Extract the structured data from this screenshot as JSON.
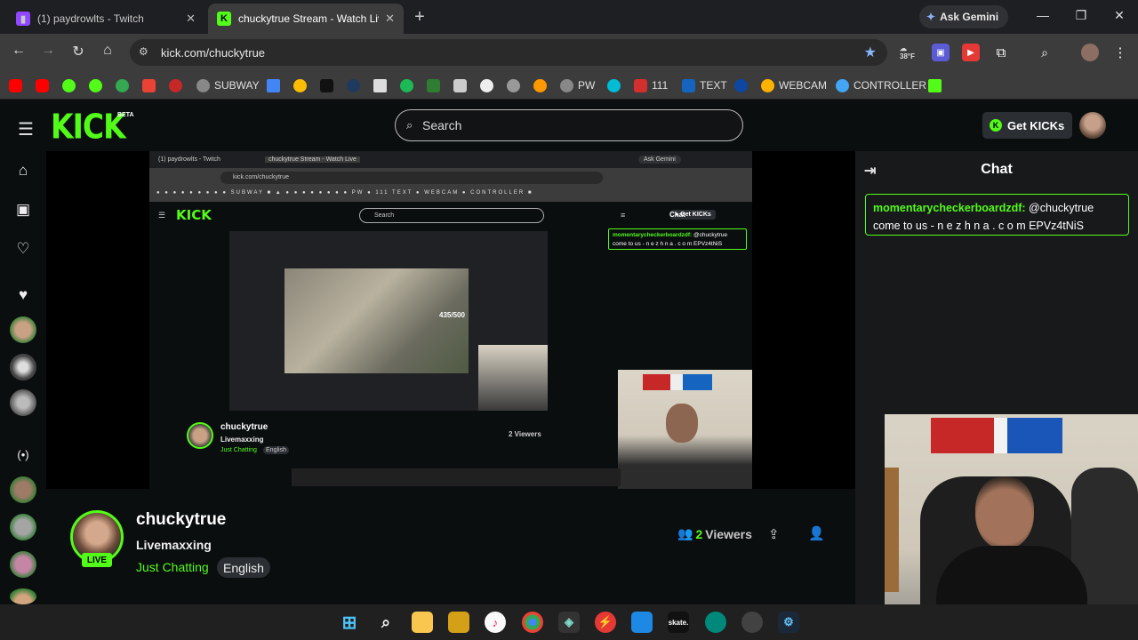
{
  "browser": {
    "tabs": [
      {
        "title": "(1) paydrowlts - Twitch",
        "active": false
      },
      {
        "title": "chuckytrue Stream - Watch Live",
        "active": true
      }
    ],
    "ask_gemini": "Ask Gemini",
    "url": "kick.com/chuckytrue",
    "weather": "38°F",
    "bookmarks": [
      "SUBWAY",
      "PW",
      "111",
      "TEXT",
      "WEBCAM",
      "CONTROLLER"
    ]
  },
  "kick": {
    "logo": "KICK",
    "beta": "BETA",
    "search_placeholder": "Search",
    "get_kicks": "Get KICKs"
  },
  "chat": {
    "title": "Chat",
    "pinned": {
      "user": "momentarycheckerboardzdf:",
      "text": " @chuckytrue come to us - n e z h n a . c o m EPVz4tNiS"
    }
  },
  "streamer": {
    "name": "chuckytrue",
    "stream_title": "Livemaxxing",
    "category": "Just Chatting",
    "language": "English",
    "live": "LIVE",
    "viewers_count": "2",
    "viewers_label": "Viewers"
  },
  "inner_capture": {
    "url": "kick.com/chuckytrue",
    "tab1": "(1) paydrowlts - Twitch",
    "tab2": "chuckytrue Stream - Watch Live",
    "ask": "Ask Gemini",
    "search": "Search",
    "chat": "Chat",
    "pinned_user": "momentarycheckerboardzdf:",
    "pinned_text": " @chuckytrue come to us - n e z h n a . c o m EPVz4tNiS",
    "name": "chuckytrue",
    "title": "Livemaxxing",
    "category": "Just Chatting",
    "lang": "English",
    "viewers": "2 Viewers",
    "game_counter": "435/500"
  },
  "colors": {
    "accent": "#53fc18",
    "bg": "#0b0e0f",
    "chat_bg": "#18191b"
  }
}
